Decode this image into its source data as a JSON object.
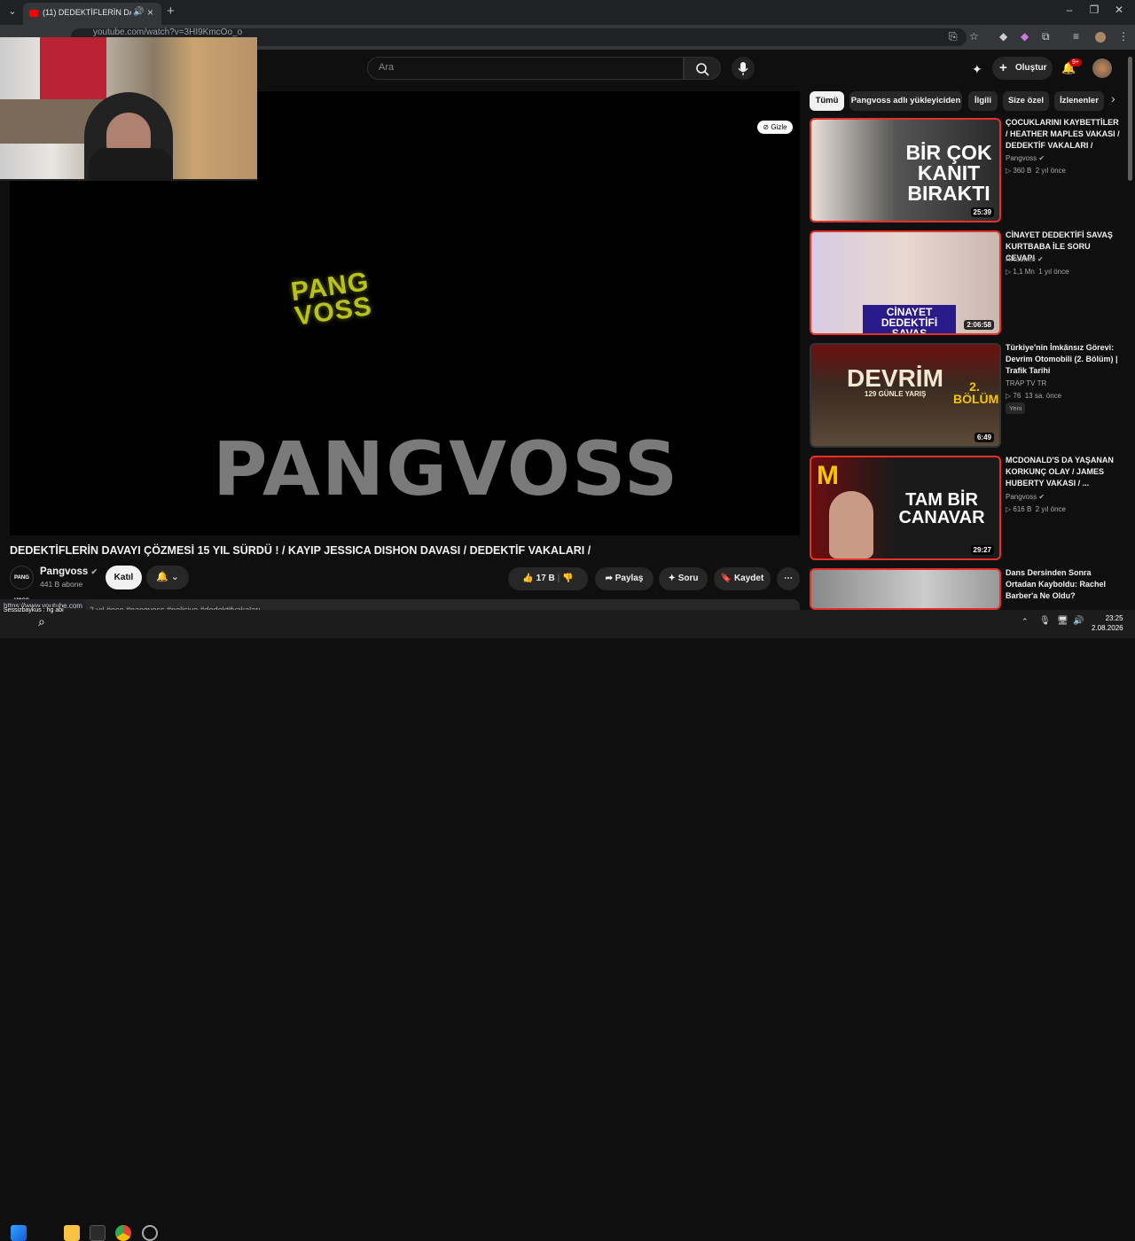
{
  "browser": {
    "tab_title": "(11) DEDEKTİFLERİN DAVAY",
    "url": "youtube.com/watch?v=3HI9KmcOo_o",
    "status_url": "https://www.youtube.com"
  },
  "header": {
    "search_placeholder": "Ara",
    "create_label": "Oluştur",
    "notification_count": "9+"
  },
  "player": {
    "hide_label": "Gizle",
    "logo_small_line1": "PANG",
    "logo_small_line2": "VOSS",
    "logo_big": "PANGVOSS"
  },
  "video": {
    "title": "DEDEKTİFLERİN DAVAYI ÇÖZMESİ 15 YIL SÜRDÜ ! / KAYIP JESSICA DISHON DAVASI / DEDEKTİF VAKALARI /",
    "channel_name": "Pangvoss",
    "channel_avatar_text": "PANG VOSS",
    "subscribers": "441 B abone",
    "join_label": "Katıl",
    "like_count": "17 B",
    "share_label": "Paylaş",
    "ask_label": "Soru",
    "save_label": "Kaydet",
    "description_preview": "2 yıl önce  #pangvoss #polisiye #dedektifvakaları"
  },
  "chips": [
    "Tümü",
    "Pangvoss adlı yükleyiciden",
    "İlgili",
    "Size özel",
    "İzlenenler"
  ],
  "recommendations": [
    {
      "title": "ÇOCUKLARINI KAYBETTİLER / HEATHER MAPLES VAKASI / DEDEKTİF VAKALARI /",
      "channel": "Pangvoss",
      "views": "360 B",
      "age": "2 yıl önce",
      "duration": "25:39",
      "thumb_text": "BİR ÇOK KANIT BIRAKTI"
    },
    {
      "title": "CİNAYET DEDEKTİFİ SAVAŞ KURTBABA İLE SORU CEVAP!",
      "channel": "RRaenee",
      "views": "1,1 Mn",
      "age": "1 yıl önce",
      "duration": "2:06:58",
      "thumb_text": "CİNAYET DEDEKTİFİ SAVAŞ KURTBABA"
    },
    {
      "title": "Türkiye'nin İmkânsız Görevi: Devrim Otomobili (2. Bölüm) | Trafik Tarihi",
      "channel": "TRAP TV TR",
      "views": "76",
      "age": "13 sa. önce",
      "duration": "6:49",
      "thumb_text": "DEVRİM",
      "thumb_sub": "129 GÜNLE YARIŞ",
      "badge": "Yeni",
      "part": "2. BÖLÜM"
    },
    {
      "title": "MCDONALD'S DA YAŞANAN KORKUNÇ OLAY / JAMES HUBERTY VAKASI / ...",
      "channel": "Pangvoss",
      "views": "616 B",
      "age": "2 yıl önce",
      "duration": "29:27",
      "thumb_text": "TAM BİR CANAVAR"
    },
    {
      "title": "Dans Dersinden Sonra Ortadan Kayboldu: Rachel Barber'a Ne Oldu?",
      "channel": "Pangvoss"
    }
  ],
  "taskbar": {
    "user_label": "Sessizbaykus : hg abi",
    "time": "23:25",
    "date": "2.08.2026"
  },
  "colors": {
    "accent": "#e6312a",
    "background": "#0f0f0f",
    "logo_yellow": "#b8c21a"
  }
}
